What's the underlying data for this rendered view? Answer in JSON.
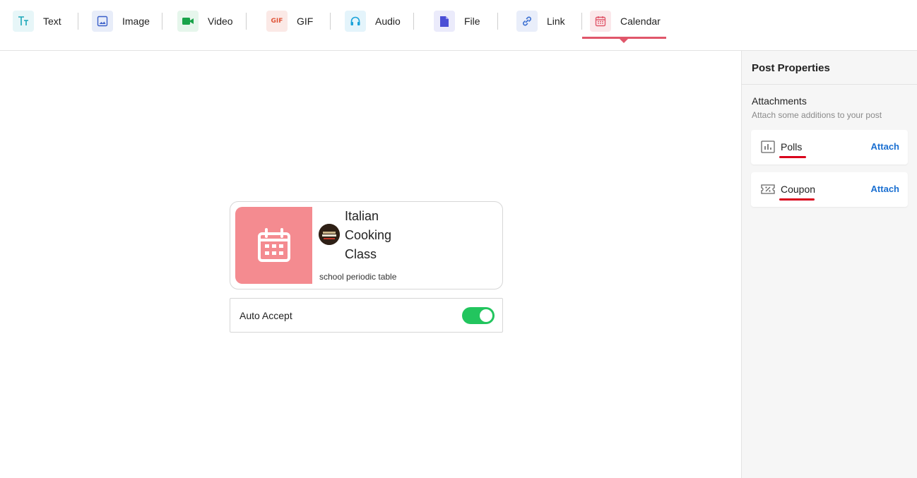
{
  "toolbar": {
    "tools": [
      {
        "label": "Text",
        "icon": "text-icon",
        "color": "#1aa6b7"
      },
      {
        "label": "Image",
        "icon": "image-icon",
        "color": "#3a5fc9"
      },
      {
        "label": "Video",
        "icon": "video-icon",
        "color": "#19a34a"
      },
      {
        "label": "GIF",
        "icon": "gif-icon",
        "color": "#e0563a"
      },
      {
        "label": "Audio",
        "icon": "headphones-icon",
        "color": "#1aa2d9"
      },
      {
        "label": "File",
        "icon": "file-icon",
        "color": "#4b4fd6"
      },
      {
        "label": "Link",
        "icon": "link-icon",
        "color": "#3a6fd1"
      },
      {
        "label": "Calendar",
        "icon": "calendar-icon",
        "color": "#e0566a"
      }
    ],
    "active": "Calendar",
    "gif_glyph": "GIF"
  },
  "event": {
    "title": "Italian Cooking Class",
    "subtitle": "school periodic table",
    "thumb_color": "#f48b90",
    "thumb_icon": "calendar-icon",
    "avatar": "restaurant-avatar"
  },
  "auto_accept": {
    "label": "Auto Accept",
    "enabled": true
  },
  "panel": {
    "title": "Post Properties",
    "attachments_title": "Attachments",
    "attachments_subtitle": "Attach some additions to your post",
    "items": [
      {
        "name": "Polls",
        "action": "Attach",
        "icon": "poll-chart-icon"
      },
      {
        "name": "Coupon",
        "action": "Attach",
        "icon": "coupon-icon"
      }
    ]
  }
}
